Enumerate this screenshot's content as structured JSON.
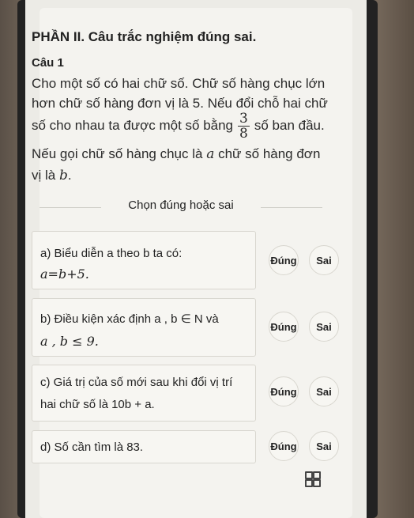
{
  "section": {
    "title": "PHẦN II. Câu trắc nghiệm đúng sai."
  },
  "question": {
    "label": "Câu 1",
    "line1": "Cho một số có hai chữ số. Chữ số hàng chục lớn",
    "line2": "hơn chữ số hàng đơn vị là 5. Nếu đổi chỗ hai chữ",
    "line3_before": "số cho nhau ta được một số bằng",
    "frac_num": "3",
    "frac_den": "8",
    "line3_after": "số ban đầu.",
    "line4_before": "Nếu gọi chữ số hàng chục là",
    "var_a": "a",
    "line4_after": "chữ số hàng đơn",
    "line5_before": "vị là",
    "var_b": "b",
    "line5_after": "."
  },
  "divider": {
    "label": "Chọn đúng hoặc sai"
  },
  "items": [
    {
      "line1": "a) Biểu diễn a theo b ta có:",
      "line2": "a=b+5."
    },
    {
      "line1": "b) Điều kiện xác định a ,   b ∈ N  và",
      "line2": "a ,  b ≤ 9."
    },
    {
      "line1": "c) Giá trị của số mới sau khi đổi vị trí",
      "line2": "hai chữ số là 10b + a."
    },
    {
      "line1": "d) Số cần tìm là 83."
    }
  ],
  "buttons": {
    "true_label": "Đúng",
    "false_label": "Sai"
  },
  "icons": {
    "grid": "grid-icon"
  }
}
